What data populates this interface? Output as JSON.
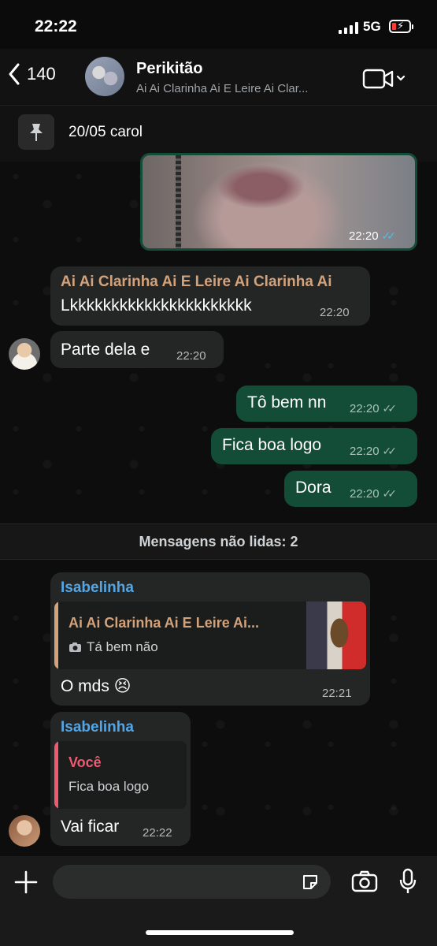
{
  "status_bar": {
    "time": "22:22",
    "network": "5G",
    "battery_level": 0.12
  },
  "header": {
    "back_count": "140",
    "title": "Perikitão",
    "subtitle": "Ai Ai Clarinha Ai E Leire Ai Clar...",
    "icons": [
      "chevron-left-icon",
      "video-call-icon",
      "chevron-down-icon"
    ]
  },
  "pinned": {
    "text": "20/05 carol",
    "icon": "pin-icon"
  },
  "messages": {
    "image_message": {
      "time": "22:20",
      "status": "read"
    },
    "msg_kkk": {
      "sender": "Ai Ai Clarinha Ai E Leire Ai Clarinha Ai",
      "text": "Lkkkkkkkkkkkkkkkkkkkkkk",
      "time": "22:20"
    },
    "msg_parte": {
      "text": "Parte dela e",
      "time": "22:20"
    },
    "out_1": {
      "text": "Tô bem nn",
      "time": "22:20"
    },
    "out_2": {
      "text": "Fica boa logo",
      "time": "22:20"
    },
    "out_3": {
      "text": "Dora",
      "time": "22:20"
    }
  },
  "unread_divider": "Mensagens não lidas: 2",
  "isabelinha_1": {
    "sender": "Isabelinha",
    "reply_name": "Ai Ai Clarinha Ai E Leire Ai...",
    "reply_text": "Tá bem não",
    "reply_icon": "camera-icon",
    "text": "O mds 😣",
    "time": "22:21"
  },
  "isabelinha_2": {
    "sender": "Isabelinha",
    "reply_name": "Você",
    "reply_text": "Fica boa logo",
    "text": "Vai ficar",
    "time": "22:22"
  },
  "colors": {
    "outgoing_bubble": "#144d37",
    "incoming_bubble": "#242626",
    "sender_orange": "#d4a27a",
    "sender_blue": "#53a6e6",
    "reply_you": "#f0596f"
  },
  "input_bar": {
    "icons": [
      "plus-icon",
      "sticker-icon",
      "camera-icon",
      "microphone-icon"
    ]
  }
}
